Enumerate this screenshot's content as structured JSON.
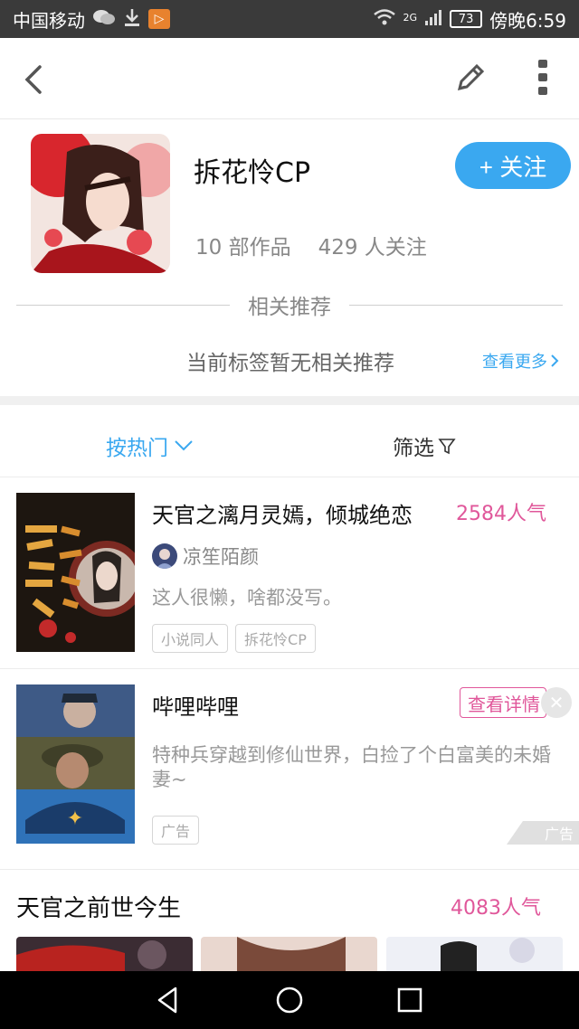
{
  "status_bar": {
    "carrier": "中国移动",
    "network": "2G",
    "battery": "73",
    "time": "傍晚6:59"
  },
  "header": {
    "back_icon": "chevron-left-icon",
    "edit_icon": "pencil-icon",
    "more_icon": "more-vertical-icon"
  },
  "profile": {
    "title": "拆花怜CP",
    "follow_label": "+ 关注",
    "works_count": "10 部作品",
    "followers_count": "429 人关注"
  },
  "recommend": {
    "section_label": "相关推荐",
    "empty_text": "当前标签暂无相关推荐",
    "see_more": "查看更多"
  },
  "sort": {
    "hot_label": "按热门",
    "filter_label": "筛选"
  },
  "works": [
    {
      "title": "天官之漓月灵嫣，倾城绝恋",
      "popularity": "2584人气",
      "author": "凉笙陌颜",
      "description": "这人很懒，啥都没写。",
      "tags": [
        "小说同人",
        "拆花怜CP"
      ]
    }
  ],
  "ad": {
    "title": "哔哩哔哩",
    "action": "查看详情",
    "description": "特种兵穿越到修仙世界，白捡了个白富美的未婚妻~",
    "tag": "广告",
    "corner_label": "广告"
  },
  "next_section": {
    "title": "天官之前世今生",
    "popularity": "4083人气"
  },
  "colors": {
    "accent_blue": "#3aa8f0",
    "accent_pink": "#e0579a"
  }
}
